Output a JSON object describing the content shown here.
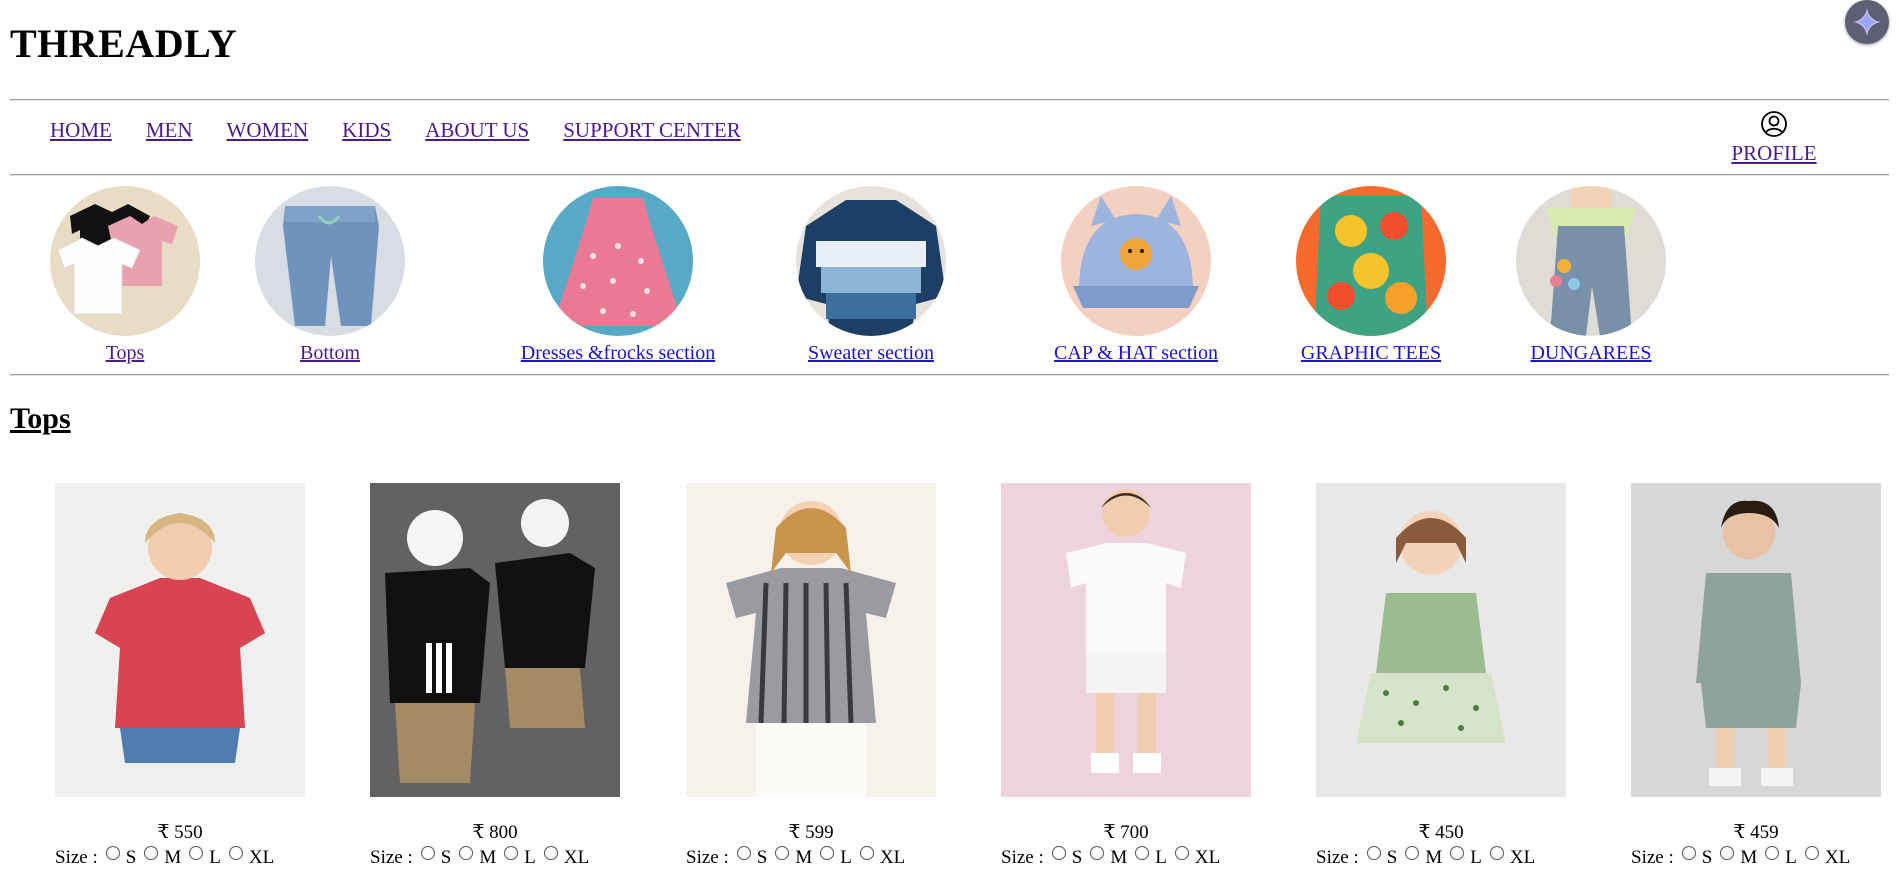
{
  "brand": "THREADLY",
  "nav": {
    "items": [
      {
        "label": "HOME"
      },
      {
        "label": "MEN"
      },
      {
        "label": "WOMEN"
      },
      {
        "label": "KIDS"
      },
      {
        "label": "ABOUT US"
      },
      {
        "label": "SUPPORT CENTER"
      }
    ],
    "profile_label": "PROFILE",
    "profile_icon": "user-circle-icon"
  },
  "categories": [
    {
      "label": "Tops",
      "icon": "tops-category-image"
    },
    {
      "label": "Bottom",
      "icon": "bottom-category-image"
    },
    {
      "label": "Dresses &frocks section",
      "icon": "dresses-category-image"
    },
    {
      "label": "Sweater section",
      "icon": "sweater-category-image"
    },
    {
      "label": "CAP & HAT section",
      "icon": "cap-category-image"
    },
    {
      "label": "GRAPHIC TEES",
      "icon": "graphic-tees-category-image"
    },
    {
      "label": "DUNGAREES",
      "icon": "dungarees-category-image"
    }
  ],
  "section": {
    "title": "Tops"
  },
  "size_label": "Size :",
  "size_options": [
    "S",
    "M",
    "L",
    "XL"
  ],
  "products": [
    {
      "price": "₹ 550",
      "image": "girl-red-gingham-top"
    },
    {
      "price": "₹ 800",
      "image": "boys-black-adidas-tees"
    },
    {
      "price": "₹ 599",
      "image": "girl-striped-ruffle-top"
    },
    {
      "price": "₹ 700",
      "image": "boy-white-new-york-tee"
    },
    {
      "price": "₹ 450",
      "image": "girl-green-floral-dress"
    },
    {
      "price": "₹ 459",
      "image": "boy-sage-hoodie-set"
    }
  ],
  "colors": {
    "link_visited": "#4b1b8c",
    "link": "#1a16c8",
    "divider": "#9a9a9a"
  }
}
